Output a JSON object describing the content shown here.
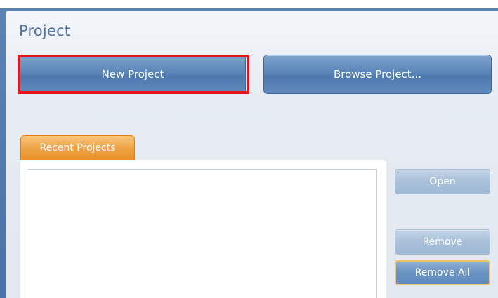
{
  "panel": {
    "title": "Project"
  },
  "buttons": {
    "new_project": "New Project",
    "browse_project": "Browse Project...",
    "open": "Open",
    "remove": "Remove",
    "remove_all": "Remove All"
  },
  "recent": {
    "tab_label": "Recent Projects",
    "items": []
  },
  "colors": {
    "accent": "#5b86b9",
    "tab_orange": "#efa447",
    "highlight": "#e8141c",
    "title_text": "#5273a4"
  }
}
